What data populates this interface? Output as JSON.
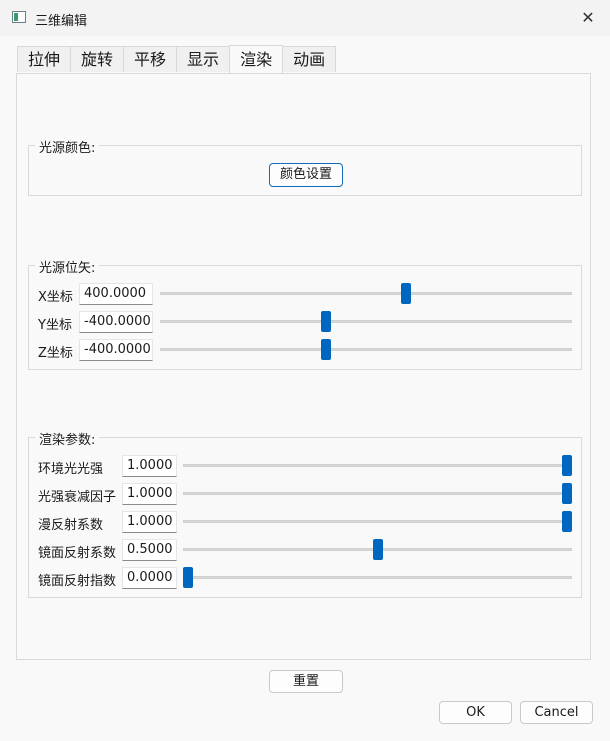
{
  "window": {
    "title": "三维编辑",
    "close_label": "✕"
  },
  "tabs": [
    {
      "label": "拉伸",
      "active": false
    },
    {
      "label": "旋转",
      "active": false
    },
    {
      "label": "平移",
      "active": false
    },
    {
      "label": "显示",
      "active": false
    },
    {
      "label": "渲染",
      "active": true
    },
    {
      "label": "动画",
      "active": false
    }
  ],
  "light_color": {
    "title": "光源颜色:",
    "button": "颜色设置"
  },
  "light_position": {
    "title": "光源位矢:",
    "rows": [
      {
        "label": "X坐标",
        "value": "400.0000",
        "slider_fraction": 0.6
      },
      {
        "label": "Y坐标",
        "value": "-400.0000",
        "slider_fraction": 0.4
      },
      {
        "label": "Z坐标",
        "value": "-400.0000",
        "slider_fraction": 0.4
      }
    ]
  },
  "render_params": {
    "title": "渲染参数:",
    "rows": [
      {
        "label": "环境光光强",
        "value": "1.0000",
        "slider_fraction": 1.0
      },
      {
        "label": "光强衰减因子",
        "value": "1.0000",
        "slider_fraction": 1.0
      },
      {
        "label": "漫反射系数",
        "value": "1.0000",
        "slider_fraction": 1.0
      },
      {
        "label": "镜面反射系数",
        "value": "0.5000",
        "slider_fraction": 0.5
      },
      {
        "label": "镜面反射指数",
        "value": "0.0000",
        "slider_fraction": 0.0
      }
    ]
  },
  "buttons": {
    "reset": "重置",
    "ok": "OK",
    "cancel": "Cancel"
  },
  "colors": {
    "accent": "#0067c0",
    "border": "#d9d9d9"
  }
}
